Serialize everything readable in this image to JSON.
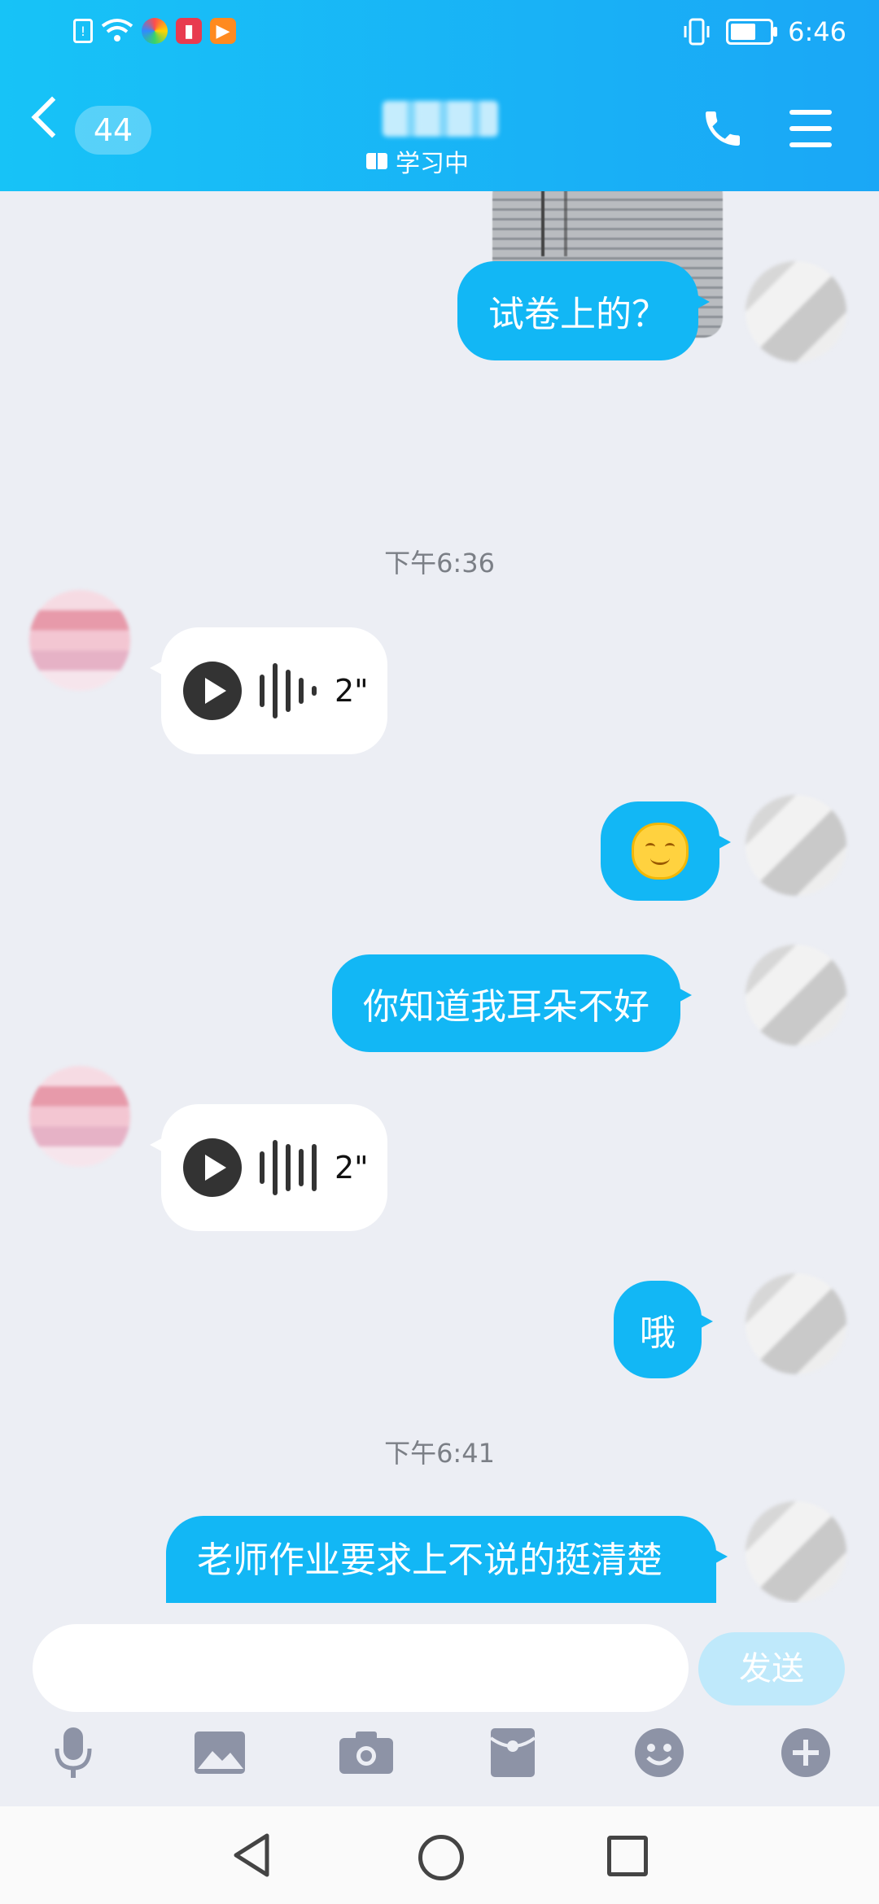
{
  "status_bar": {
    "time": "6:46"
  },
  "header": {
    "unread_count": "44",
    "subtitle": "学习中"
  },
  "chat": {
    "messages": [
      {
        "from": "me",
        "type": "text",
        "text": "试卷上的？"
      },
      {
        "type": "time",
        "text": "下午6:36"
      },
      {
        "from": "them",
        "type": "voice",
        "duration": "2\""
      },
      {
        "from": "me",
        "type": "emoji",
        "emoji": "smile-emoji"
      },
      {
        "from": "me",
        "type": "text",
        "text": "你知道我耳朵不好"
      },
      {
        "from": "them",
        "type": "voice",
        "duration": "2\""
      },
      {
        "from": "me",
        "type": "text",
        "text": "哦"
      },
      {
        "type": "time",
        "text": "下午6:41"
      },
      {
        "from": "me",
        "type": "text",
        "text": "老师作业要求上不说的挺清楚"
      }
    ]
  },
  "input": {
    "value": "",
    "send_label": "发送"
  },
  "toolbar": [
    "microphone-icon",
    "image-icon",
    "camera-icon",
    "red-packet-icon",
    "emoji-icon",
    "plus-icon"
  ],
  "colors": {
    "header": "#17c3f7",
    "my_bubble": "#12b7f5",
    "background": "#eceef4"
  }
}
